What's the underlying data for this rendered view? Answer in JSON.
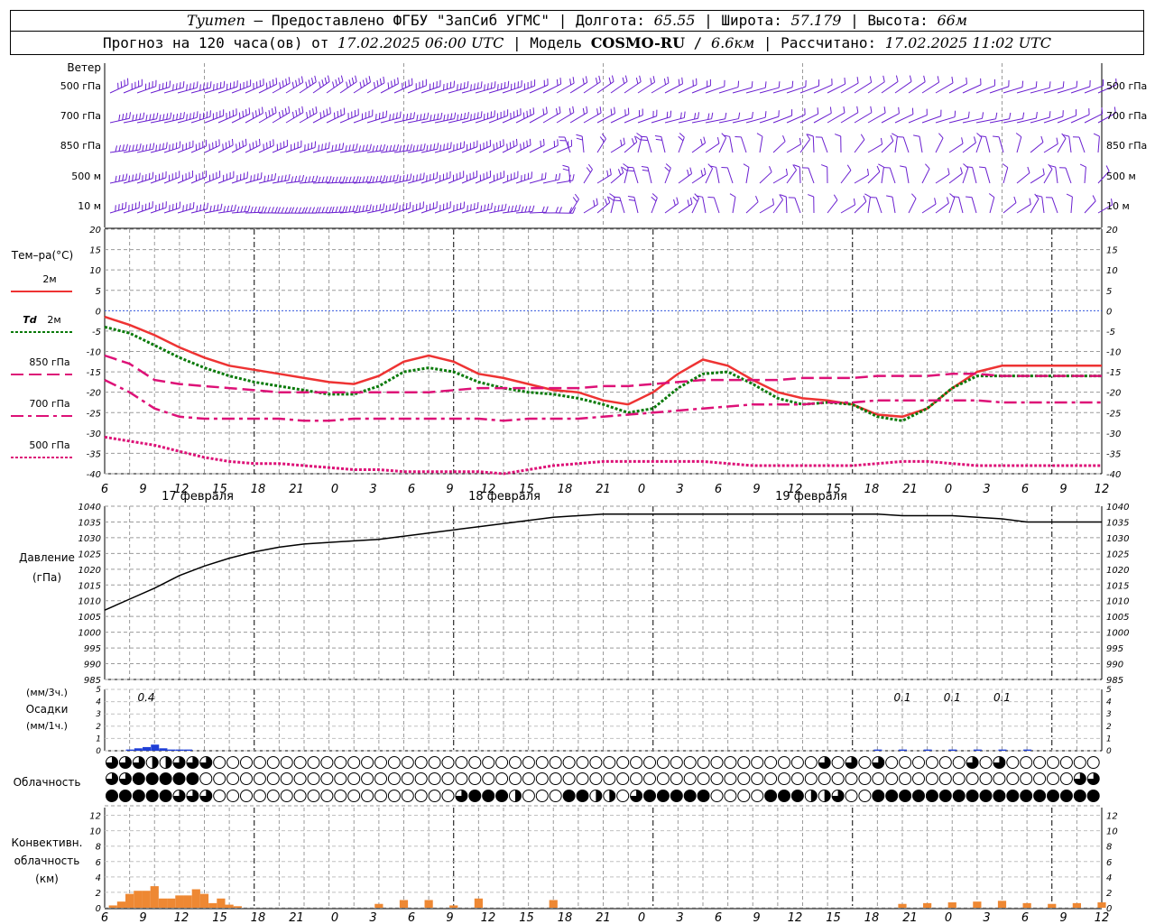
{
  "header": {
    "city": "Tyumen",
    "sep0": " – ",
    "provider": "Предоставлено ФГБУ \"ЗапСиб УГМС\"",
    "lon_label": "Долгота:",
    "lon_value": "65.55",
    "lat_label": "Широта:",
    "lat_value": "57.179",
    "alt_label": "Высота:",
    "alt_value": "66м",
    "forecast_prefix": "Прогноз на 120 часа(ов) от",
    "forecast_time": "17.02.2025 06:00 UTC",
    "model_label": "Модель",
    "model_name": "COSMO-RU",
    "model_res": "6.6км",
    "calc_label": "Рассчитано:",
    "calc_time": "17.02.2025 11:02 UTC",
    "sep": " | "
  },
  "colors": {
    "t2m": "#ee3333",
    "td2m": "#0a7a0a",
    "t850": "#dd1177",
    "t700": "#dd1177",
    "t500": "#dd1177",
    "pressure": "#000000",
    "precip": "#1f3fd6",
    "convective": "#ee8833",
    "wind": "#6a1fd0",
    "zero_line": "#3355dd"
  },
  "x_axis": {
    "hour_labels": [
      "6",
      "9",
      "12",
      "15",
      "18",
      "21",
      "0",
      "3",
      "6",
      "9",
      "12",
      "15",
      "18",
      "21",
      "0",
      "3",
      "6",
      "9",
      "12",
      "15",
      "18",
      "21",
      "0",
      "3",
      "6",
      "9",
      "12"
    ],
    "date_labels": [
      "17 февраля",
      "18 февраля",
      "19 февраля"
    ]
  },
  "wind_panel": {
    "title": "Ветер",
    "levels": [
      "500 гПа",
      "700 гПа",
      "850 гПа",
      "500 м",
      "10 м"
    ]
  },
  "temp_panel": {
    "title": "Тем–ра(°C)",
    "legend": [
      {
        "key": "t2m",
        "label": "2м"
      },
      {
        "key": "td2m",
        "label_italic": "Td",
        "label": "2м"
      },
      {
        "key": "t850",
        "label": "850 гПа"
      },
      {
        "key": "t700",
        "label": "700 гПа"
      },
      {
        "key": "t500",
        "label": "500 гПа"
      }
    ]
  },
  "pressure_panel": {
    "title1": "Давление",
    "title2": "(гПа)"
  },
  "precip_panel": {
    "title_top": "(мм/3ч.)",
    "title_mid": "Осадки",
    "title_bot": "(мм/1ч.)",
    "value_labels": [
      {
        "hour": 6,
        "text": "0.4"
      },
      {
        "hour": 96,
        "text": "0.1"
      },
      {
        "hour": 102,
        "text": "0.1"
      },
      {
        "hour": 108,
        "text": "0.1"
      }
    ]
  },
  "cloud_panel": {
    "title": "Облачность"
  },
  "conv_panel": {
    "title1": "Конвективн.",
    "title2": "облачность",
    "title3": "(км)"
  },
  "chart_data": [
    {
      "type": "line",
      "title": "Тем–ра(°C)",
      "x_hours_from_start": [
        0,
        3,
        6,
        9,
        12,
        15,
        18,
        21,
        24,
        27,
        30,
        33,
        36,
        39,
        42,
        45,
        48,
        51,
        54,
        57,
        60,
        63,
        66,
        69,
        72,
        75,
        78,
        81,
        84,
        87,
        90,
        93,
        96,
        99,
        102,
        105,
        108,
        111,
        114,
        117,
        120
      ],
      "ylim": [
        -40,
        20
      ],
      "yticks": [
        20,
        15,
        10,
        5,
        0,
        -5,
        -10,
        -15,
        -20,
        -25,
        -30,
        -35,
        -40
      ],
      "series": [
        {
          "name": "2м",
          "style": "solid",
          "values": [
            -1.5,
            -3.5,
            -6,
            -9,
            -11.5,
            -13.5,
            -14.5,
            -15.5,
            -16.5,
            -17.5,
            -18,
            -16,
            -12.5,
            -11,
            -12.5,
            -15.5,
            -16.5,
            -18,
            -19.5,
            -20,
            -22,
            -23,
            -20,
            -15.5,
            -12,
            -13.5,
            -17,
            -20,
            -21.5,
            -22,
            -23,
            -25.5,
            -26,
            -24,
            -19,
            -15,
            -13.5,
            -13.5,
            -13.5,
            -13.5,
            -13.5
          ]
        },
        {
          "name": "Td 2м",
          "style": "dotted",
          "values": [
            -4,
            -5.5,
            -8.5,
            -11.5,
            -14,
            -16,
            -17.5,
            -18.5,
            -19.5,
            -20.5,
            -20.5,
            -18.5,
            -15,
            -14,
            -15,
            -17.5,
            -19,
            -20,
            -20.5,
            -21.5,
            -23,
            -25,
            -24,
            -19,
            -15.5,
            -15,
            -18,
            -21.5,
            -23,
            -22.5,
            -23,
            -26,
            -27,
            -24,
            -19,
            -16,
            -16,
            -16,
            -16,
            -16,
            -16
          ]
        },
        {
          "name": "850 гПа",
          "style": "dash",
          "values": [
            -11,
            -13,
            -17,
            -18,
            -18.5,
            -19,
            -19.5,
            -20,
            -20,
            -20,
            -20,
            -20,
            -20,
            -20,
            -19.5,
            -19,
            -19,
            -19,
            -19,
            -19,
            -18.5,
            -18.5,
            -18,
            -17.5,
            -17,
            -17,
            -17,
            -17,
            -16.5,
            -16.5,
            -16.5,
            -16,
            -16,
            -16,
            -15.5,
            -15.5,
            -16,
            -16,
            -16,
            -16,
            -16
          ]
        },
        {
          "name": "700 гПа",
          "style": "dashdot",
          "values": [
            -17,
            -20,
            -24,
            -26,
            -26.5,
            -26.5,
            -26.5,
            -26.5,
            -27,
            -27,
            -26.5,
            -26.5,
            -26.5,
            -26.5,
            -26.5,
            -26.5,
            -27,
            -26.5,
            -26.5,
            -26.5,
            -26,
            -25.5,
            -25,
            -24.5,
            -24,
            -23.5,
            -23,
            -23,
            -23,
            -22.5,
            -22.5,
            -22,
            -22,
            -22,
            -22,
            -22,
            -22.5,
            -22.5,
            -22.5,
            -22.5,
            -22.5
          ]
        },
        {
          "name": "500 гПа",
          "style": "dotted",
          "values": [
            -31,
            -32,
            -33,
            -34.5,
            -36,
            -37,
            -37.5,
            -37.5,
            -38,
            -38.5,
            -39,
            -39,
            -39.5,
            -39.5,
            -39.5,
            -39.5,
            -40,
            -39,
            -38,
            -37.5,
            -37,
            -37,
            -37,
            -37,
            -37,
            -37.5,
            -38,
            -38,
            -38,
            -38,
            -38,
            -37.5,
            -37,
            -37,
            -37.5,
            -38,
            -38,
            -38,
            -38,
            -38,
            -38
          ]
        }
      ]
    },
    {
      "type": "line",
      "title": "Давление (гПа)",
      "x_hours_from_start": [
        0,
        3,
        6,
        9,
        12,
        15,
        18,
        21,
        24,
        27,
        30,
        33,
        36,
        39,
        42,
        45,
        48,
        51,
        54,
        57,
        60,
        63,
        66,
        69,
        72,
        75,
        78,
        81,
        84,
        87,
        90,
        93,
        96,
        99,
        102,
        105,
        108,
        111,
        114,
        117,
        120
      ],
      "ylim": [
        985,
        1040
      ],
      "yticks": [
        1040,
        1035,
        1030,
        1025,
        1020,
        1015,
        1010,
        1005,
        1000,
        995,
        990,
        985
      ],
      "series": [
        {
          "name": "Давление",
          "values": [
            1007,
            1010.5,
            1014,
            1018,
            1021,
            1023.5,
            1025.5,
            1027,
            1028,
            1028.5,
            1029,
            1029.5,
            1030.5,
            1031.5,
            1032.5,
            1033.5,
            1034.5,
            1035.5,
            1036.5,
            1037,
            1037.5,
            1037.5,
            1037.5,
            1037.5,
            1037.5,
            1037.5,
            1037.5,
            1037.5,
            1037.5,
            1037.5,
            1037.5,
            1037.5,
            1037,
            1037,
            1037,
            1036.5,
            1036,
            1035,
            1035,
            1035,
            1035
          ]
        }
      ]
    },
    {
      "type": "bar",
      "title": "Осадки (мм/3ч.)",
      "ylim": [
        0,
        5
      ],
      "yticks": [
        5,
        4,
        3,
        2,
        1,
        0
      ],
      "x_hours_from_start": [
        3,
        4,
        5,
        6,
        7,
        8,
        9,
        10,
        93,
        96,
        99,
        102,
        105,
        108,
        111
      ],
      "values": [
        0.1,
        0.2,
        0.3,
        0.5,
        0.2,
        0.1,
        0.1,
        0.1,
        0.1,
        0.1,
        0.1,
        0.1,
        0.1,
        0.1,
        0.1
      ]
    },
    {
      "type": "bar",
      "title": "Конвективн. облачность (км)",
      "ylim": [
        0,
        13
      ],
      "yticks": [
        12,
        10,
        8,
        6,
        4,
        2,
        0
      ],
      "x_hours_from_start": [
        1,
        2,
        3,
        4,
        5,
        6,
        7,
        8,
        9,
        10,
        11,
        12,
        13,
        14,
        15,
        16,
        33,
        36,
        39,
        42,
        45,
        54,
        96,
        99,
        102,
        105,
        108,
        111,
        114,
        117,
        120
      ],
      "values": [
        0.3,
        0.8,
        1.8,
        2.2,
        2.2,
        2.8,
        1.2,
        1.2,
        1.6,
        1.6,
        2.4,
        1.8,
        0.6,
        1.2,
        0.4,
        0.2,
        0.5,
        1.0,
        1.0,
        0.3,
        1.2,
        1.0,
        0.5,
        0.6,
        0.7,
        0.8,
        0.9,
        0.6,
        0.5,
        0.6,
        0.7
      ]
    }
  ],
  "cloud_rows": [
    "qqqhhqqqeeeeeeeeeeeeeeeeeeeeeeeeeeeeeeeeeeeeeeeeeeeeeqeqeqeeeeeeqeqeeeeeeeehhhhh",
    "qqfffffeeeeeeeeeeeeeeeeeeeeeeeeeeeeeeeeeeeeeeeeeeeeeeeeeeeeeeeeeeeeeeeeeqqqqqqhfff",
    "fffffqqqeeeeeeeeeeeeeeeeeeqfffheeeffhheqfffffeeeefffhhqeeffffffffffffffffffffeee"
  ]
}
